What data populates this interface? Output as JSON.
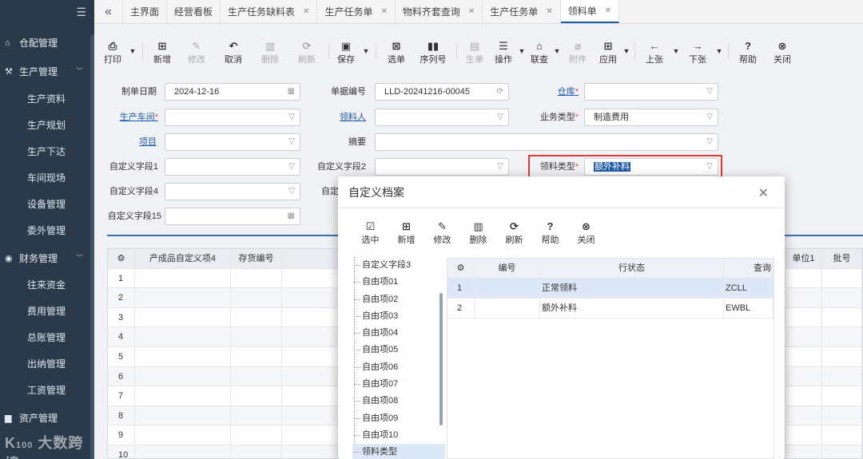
{
  "sidebar": {
    "groups": [
      {
        "label": "仓配管理",
        "icon": "home-icon"
      },
      {
        "label": "生产管理",
        "icon": "factory-icon"
      },
      {
        "label": "财务管理",
        "icon": "finance-icon"
      },
      {
        "label": "资产管理",
        "icon": "asset-icon"
      }
    ],
    "production_items": [
      "生产资料",
      "生产规划",
      "生产下达",
      "车间现场",
      "设备管理",
      "委外管理"
    ],
    "finance_items": [
      "往来资金",
      "费用管理",
      "总账管理",
      "出纳管理",
      "工资管理"
    ],
    "watermark": "大数跨境"
  },
  "tabs": [
    {
      "label": "主界面",
      "closable": false
    },
    {
      "label": "经营看板",
      "closable": false
    },
    {
      "label": "生产任务缺料表",
      "closable": true
    },
    {
      "label": "生产任务单",
      "closable": true
    },
    {
      "label": "物料齐套查询",
      "closable": true
    },
    {
      "label": "生产任务单",
      "closable": true
    },
    {
      "label": "领料单",
      "closable": true,
      "active": true
    }
  ],
  "toolbar": {
    "print": "打印",
    "new": "新增",
    "edit": "修改",
    "cancel": "取消",
    "delete": "删除",
    "refresh": "刷新",
    "save": "保存",
    "select": "选单",
    "serial": "序列号",
    "generate": "生单",
    "operate": "操作",
    "audit": "联查",
    "attachment": "附件",
    "apply": "应用",
    "prev": "上张",
    "next": "下张",
    "help": "帮助",
    "close": "关闭"
  },
  "form": {
    "date_label": "制单日期",
    "date_value": "2024-12-16",
    "docno_label": "单据编号",
    "docno_value": "LLD-20241216-00045",
    "warehouse_label": "仓库",
    "workshop_label": "生产车间",
    "picker_label": "领料人",
    "biztype_label": "业务类型",
    "biztype_value": "制造费用",
    "project_label": "项目",
    "summary_label": "摘要",
    "custom1_label": "自定义字段1",
    "custom2_label": "自定义字段2",
    "pick_type_label": "领料类型",
    "pick_type_value": "额外补料",
    "custom4_label": "自定义字段4",
    "custom5_label_partial": "自定",
    "custom15_label": "自定义字段15"
  },
  "grid": {
    "headers": [
      "产成品自定义项4",
      "存货编号"
    ],
    "right_headers": [
      "单位1",
      "批号"
    ],
    "row_numbers": [
      "1",
      "2",
      "3",
      "4",
      "5",
      "6",
      "7",
      "8",
      "9",
      "10"
    ]
  },
  "modal": {
    "title": "自定义档案",
    "tools": [
      "选中",
      "新增",
      "修改",
      "删除",
      "刷新",
      "帮助",
      "关闭"
    ],
    "tree": [
      "自定义字段3",
      "自由项01",
      "自由项02",
      "自由项03",
      "自由项04",
      "自由项05",
      "自由项06",
      "自由项07",
      "自由项08",
      "自由项09",
      "自由项10",
      "领料类型"
    ],
    "table_headers": [
      "编号",
      "行状态",
      "查询"
    ],
    "rows": [
      {
        "no": "1",
        "status": "正常领料",
        "code": "ZCLL"
      },
      {
        "no": "2",
        "status": "额外补料",
        "code": "EWBL"
      }
    ]
  }
}
